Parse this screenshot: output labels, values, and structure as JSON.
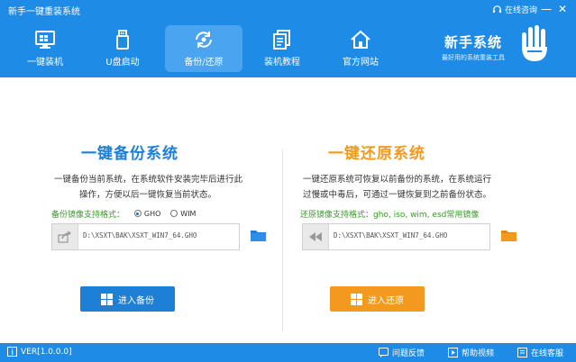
{
  "app": {
    "title": "新手一键重装系统"
  },
  "titlebar": {
    "online_consult": "在线咨询",
    "minimize": "—",
    "close": "✕"
  },
  "nav": [
    {
      "label": "一键装机",
      "icon": "monitor-icon",
      "active": false
    },
    {
      "label": "U盘启动",
      "icon": "usb-icon",
      "active": false
    },
    {
      "label": "备份/还原",
      "icon": "backup-icon",
      "active": true
    },
    {
      "label": "装机教程",
      "icon": "tutorial-icon",
      "active": false
    },
    {
      "label": "官方网站",
      "icon": "home-icon",
      "active": false
    }
  ],
  "brand": {
    "name": "新手系统",
    "sub": "最好用的系统重装工具"
  },
  "backup": {
    "title": "一键备份系统",
    "desc_line1": "一键备份当前系统，在系统软件安装完毕后进行此",
    "desc_line2": "操作，方便以后一键恢复当前状态。",
    "format_label": "备份镜像支持格式：",
    "formats": [
      {
        "label": "GHO",
        "selected": true
      },
      {
        "label": "WIM",
        "selected": false
      }
    ],
    "path": "D:\\XSXT\\BAK\\XSXT_WIN7_64.GHO",
    "button_label": "进入备份",
    "title_color": "#1e7fd6",
    "button_color": "#1e7fd6"
  },
  "restore": {
    "title": "一键还原系统",
    "desc_line1": "一键还原系统可恢复以前备份的系统，在系统运行",
    "desc_line2": "过慢或中毒后，可通过一键恢复到之前备份状态。",
    "format_label": "还原镜像支持格式：gho, iso, wim, esd常用镜像",
    "path": "D:\\XSXT\\BAK\\XSXT_WIN7_64.GHO",
    "button_label": "进入还原",
    "title_color": "#f39a1e",
    "button_color": "#f39a1e"
  },
  "bottombar": {
    "version": "VER[1.0.0.0]",
    "feedback": "问题反馈",
    "help_video": "帮助视频",
    "online_service": "在线客服"
  }
}
